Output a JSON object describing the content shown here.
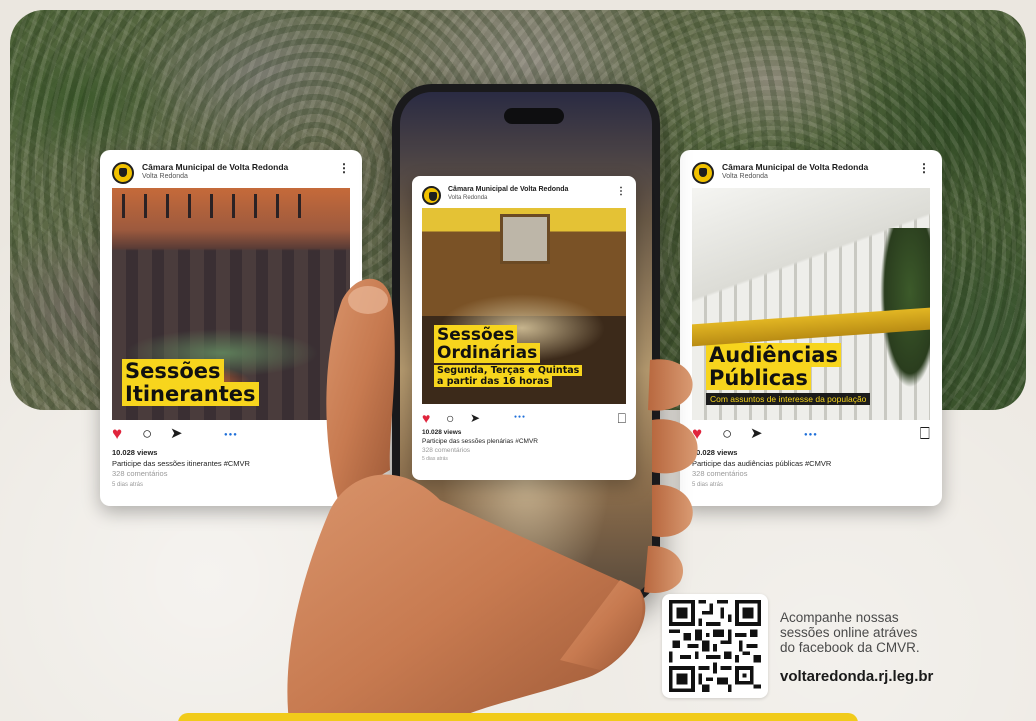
{
  "colors": {
    "brand_yellow": "#f7d51d",
    "like_red": "#e0243c",
    "hashtag_blue": "#1e6fd9",
    "background": "#ebe7e0"
  },
  "account": {
    "name": "Câmara Municipal de Volta Redonda",
    "location": "Volta Redonda",
    "avatar_icon": "camera-municipal-logo"
  },
  "cards": {
    "left": {
      "title_line1": "Sessões",
      "title_line2": "Itinerantes",
      "views": "10.028 views",
      "caption": "Participe das sessões itinerantes #CMVR",
      "comments": "328 comentários",
      "time": "5 dias atrás"
    },
    "center": {
      "title_line1": "Sessões",
      "title_line2": "Ordinárias",
      "sub_line1": "Segunda, Terças e Quintas",
      "sub_line2": "a partir das 16 horas",
      "views": "10.028 views",
      "caption": "Participe das sessões plenárias #CMVR",
      "comments": "328 comentários",
      "time": "5 dias atrás"
    },
    "right": {
      "title_line1": "Audiências",
      "title_line2": "Públicas",
      "sub": "Com assuntos de interesse da população",
      "views": "10.028 views",
      "caption": "Participe das audiências públicas #CMVR",
      "comments": "328 comentários",
      "time": "5 dias atrás"
    }
  },
  "icons": {
    "like": "heart-icon",
    "comment": "comment-icon",
    "share": "send-icon",
    "save": "bookmark-icon",
    "more": "more-icon"
  },
  "footer": {
    "cta_line1": "Acompanhe nossas",
    "cta_line2": "sessões online atráves",
    "cta_line3": "do facebook da CMVR.",
    "url": "voltaredonda.rj.leg.br"
  }
}
